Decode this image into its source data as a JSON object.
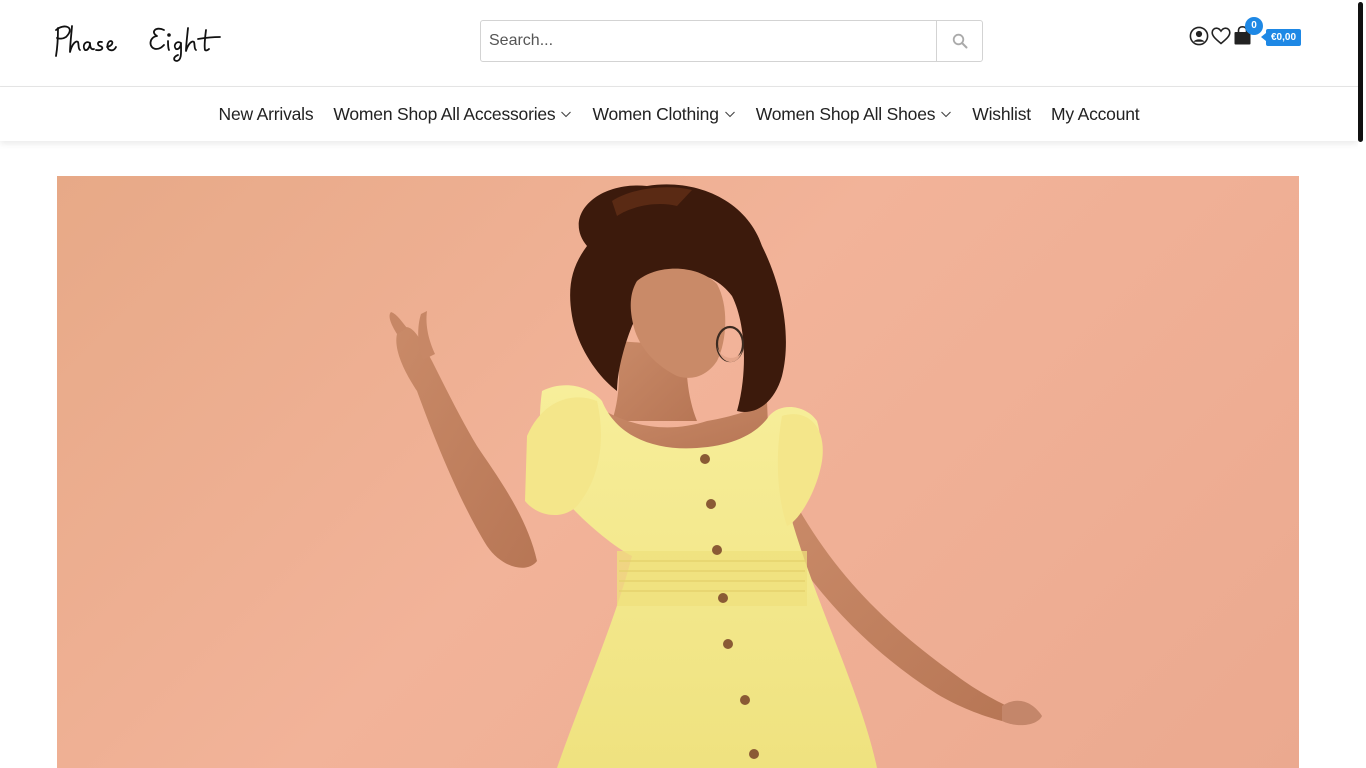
{
  "brand": {
    "name": "Phase Eight"
  },
  "search": {
    "placeholder": "Search...",
    "value": ""
  },
  "header": {
    "icons": [
      "user-icon",
      "heart-icon",
      "shopping-bag-icon"
    ],
    "cart_count": "0",
    "cart_total": "€0,00",
    "accent_color": "#1e88e5"
  },
  "nav": {
    "items": [
      {
        "label": "New Arrivals"
      },
      {
        "label": "Women Shop All Accessories"
      },
      {
        "label": "Women Clothing"
      },
      {
        "label": "Women Shop All Shoes"
      },
      {
        "label": "Wishlist"
      },
      {
        "label": "My Account"
      }
    ]
  },
  "hero": {
    "background_color": "#f0b095",
    "dress_color": "#f5ea92"
  }
}
